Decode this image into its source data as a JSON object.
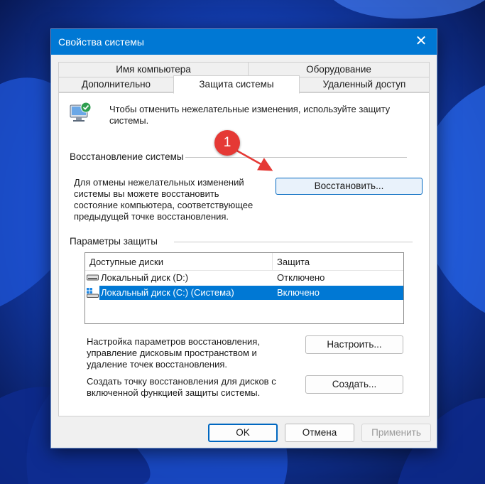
{
  "window": {
    "title": "Свойства системы"
  },
  "tabs": [
    {
      "label": "Имя компьютера"
    },
    {
      "label": "Оборудование"
    },
    {
      "label": "Дополнительно"
    },
    {
      "label": "Защита системы"
    },
    {
      "label": "Удаленный доступ"
    }
  ],
  "intro_text": "Чтобы отменить нежелательные изменения, используйте защиту системы.",
  "restore": {
    "group_title": "Восстановление системы",
    "description": "Для отмены нежелательных изменений системы вы можете восстановить состояние компьютера, соответствующее предыдущей точке восстановления.",
    "button": "Восстановить...",
    "callout_number": "1"
  },
  "protection": {
    "group_title": "Параметры защиты",
    "columns": [
      "Доступные диски",
      "Защита"
    ],
    "rows": [
      {
        "drive": "Локальный диск (D:)",
        "status": "Отключено",
        "selected": false
      },
      {
        "drive": "Локальный диск (C:) (Система)",
        "status": "Включено",
        "selected": true
      }
    ],
    "configure_text": "Настройка параметров восстановления, управление дисковым пространством и удаление точек восстановления.",
    "configure_button": "Настроить...",
    "create_text": "Создать точку восстановления для дисков с включенной функцией защиты системы.",
    "create_button": "Создать..."
  },
  "footer": {
    "ok": "OK",
    "cancel": "Отмена",
    "apply": "Применить"
  },
  "colors": {
    "titlebar": "#0078d4",
    "selection": "#0078d4",
    "callout": "#e53935"
  }
}
